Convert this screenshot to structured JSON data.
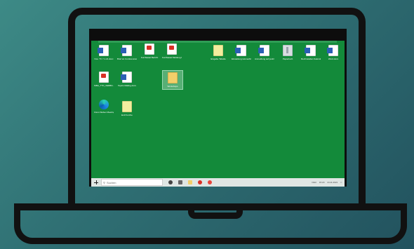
{
  "desktop": {
    "icons": [
      {
        "label": "Nov. TV 7.1.21.docx",
        "type": "word"
      },
      {
        "label": "Brief an Conferencetabel.docx",
        "type": "word"
      },
      {
        "label": "Kurzfassat Bericht",
        "type": "pdf"
      },
      {
        "label": "Kurzfassat Meldung Beginft",
        "type": "pdf"
      },
      {
        "label": "Eingabe Tabelle",
        "type": "xlsx"
      },
      {
        "label": "Einstellung Homeofice.docx",
        "type": "word"
      },
      {
        "label": "Anmeldung auf justiz.docx",
        "type": "word"
      },
      {
        "label": "Papierkorb",
        "type": "zip"
      },
      {
        "label": "Rechnstellen Kalender computer",
        "type": "word"
      },
      {
        "label": "Word.docx",
        "type": "word"
      },
      {
        "label": "SIBA_TTO_VERBN...",
        "type": "pdf"
      },
      {
        "label": "Topics Mailing.docx",
        "type": "word"
      },
      {
        "label": "Workshops",
        "type": "folder"
      },
      {
        "label": "Cisco Webex Meetings",
        "type": "edge"
      },
      {
        "label": "Entf Kurzbe",
        "type": "xlsx"
      }
    ]
  },
  "taskbar": {
    "search_placeholder": "Suchen",
    "tray_text": "15:20",
    "tray_date": "24.11.2021",
    "tray_lang": "DEU"
  }
}
